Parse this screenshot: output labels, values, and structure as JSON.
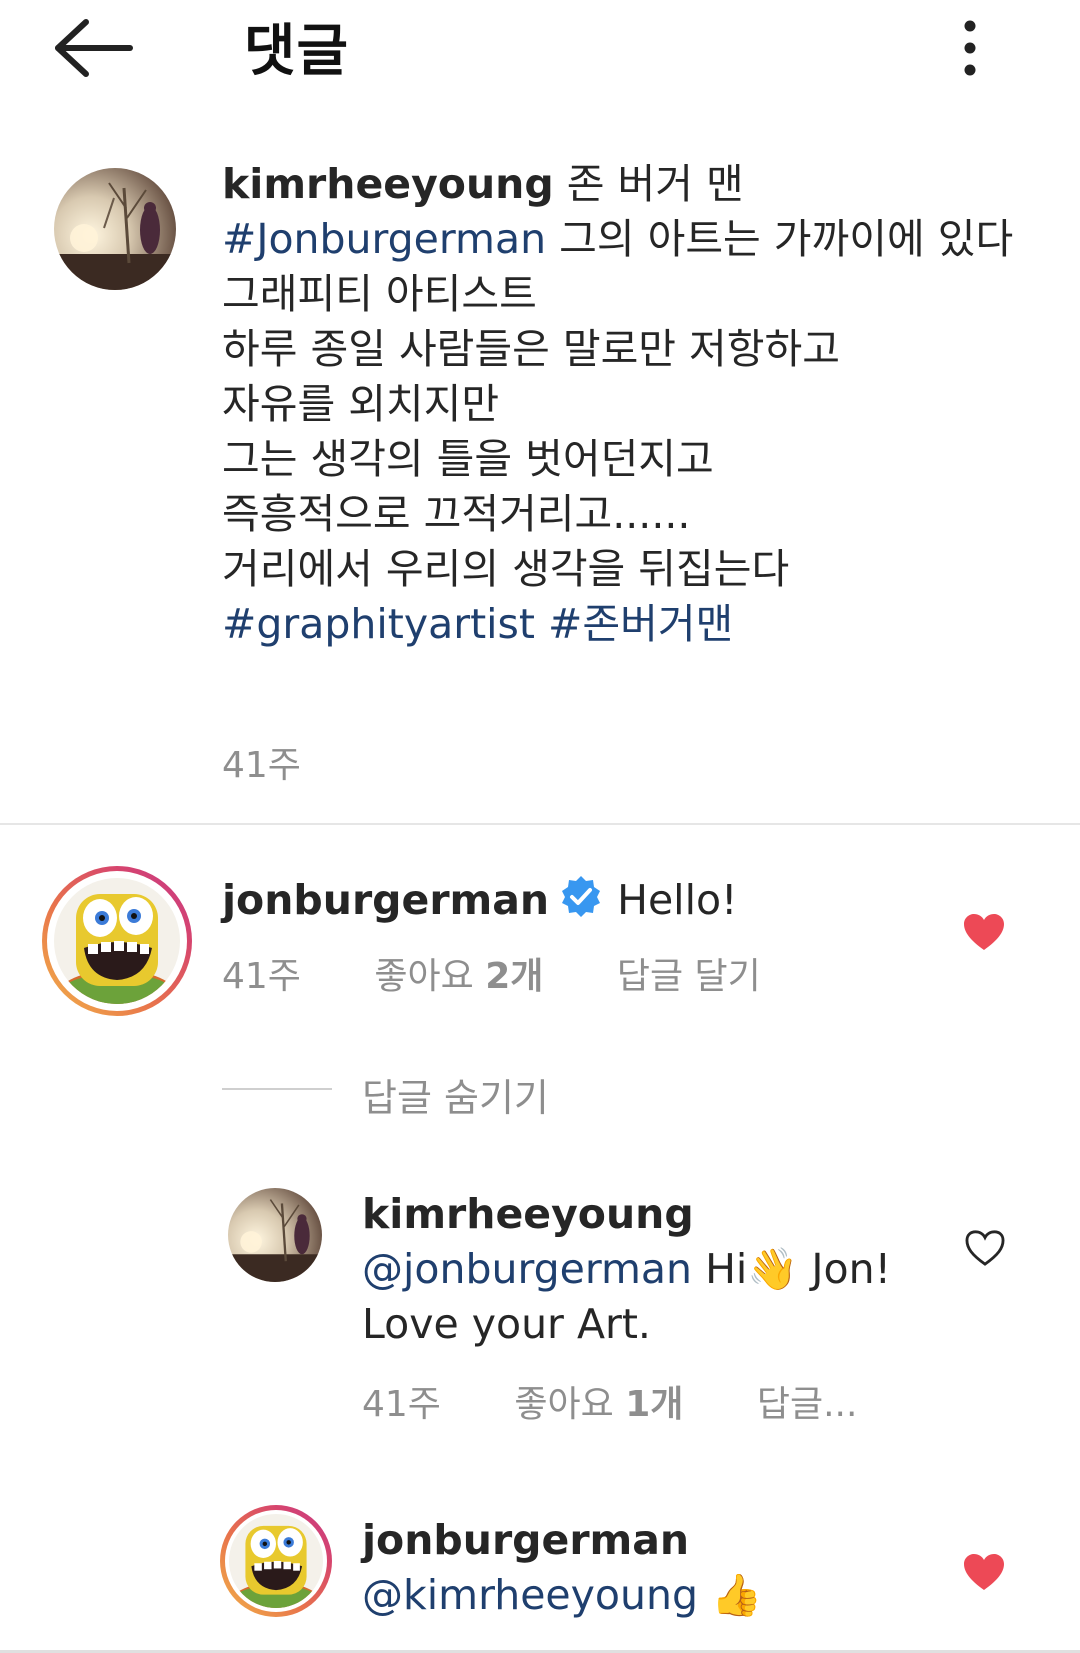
{
  "header": {
    "title": "댓글",
    "back_icon": "arrow-left-icon",
    "more_icon": "more-vertical-icon"
  },
  "caption": {
    "username": "kimrheeyoung",
    "line1_text": " 존 버거 맨",
    "hashtag1": "#Jonburgerman",
    "line2_text": " 그의 아트는 가까이에 있다",
    "line3": "그래피티 아티스트",
    "line4": "하루 종일 사람들은 말로만 저항하고",
    "line5": "자유를 외치지만",
    "line6": "그는 생각의 틀을 벗어던지고",
    "line7": "즉흥적으로 끄적거리고......",
    "line8": "거리에서 우리의 생각을 뒤집는다",
    "hashtag2": "#graphityartist",
    "hashtag3": "#존버거맨",
    "time": "41주"
  },
  "comment1": {
    "username": "jonburgerman",
    "text": "Hello!",
    "time": "41주",
    "likes_label": "좋아요 ",
    "likes_count": "2개",
    "reply_label": "답글 달기",
    "liked": true
  },
  "replies": {
    "hide_label": "답글 숨기기"
  },
  "reply1": {
    "username": "kimrheeyoung",
    "mention": "@jonburgerman",
    "text_a": " Hi",
    "emoji": "👋",
    "text_b": " Jon!",
    "text_c": "Love your Art.",
    "time": "41주",
    "likes_label": "좋아요 ",
    "likes_count": "1개",
    "reply_label": "답글...",
    "liked": false
  },
  "reply2": {
    "username": "jonburgerman",
    "mention": "@kimrheeyoung",
    "emoji": "👍",
    "liked": true
  },
  "colors": {
    "heart_liked": "#ed4956",
    "hashtag": "#1f3f6e",
    "verified": "#3897f0",
    "muted": "#8e8e8e"
  }
}
